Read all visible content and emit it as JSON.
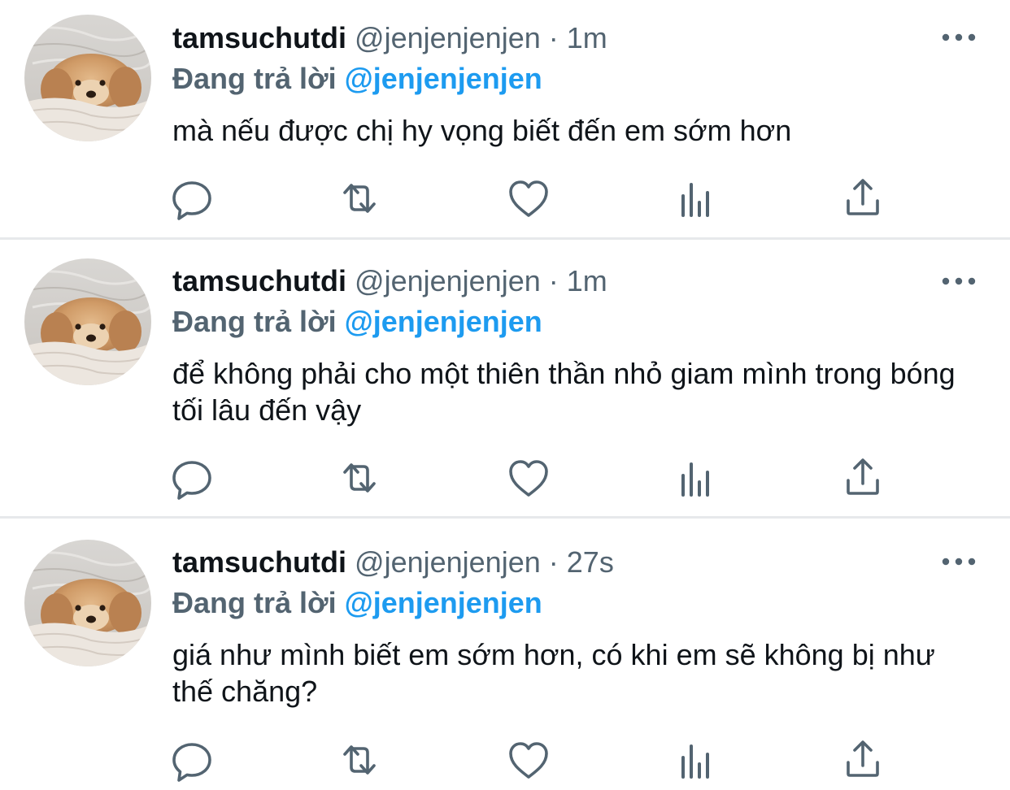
{
  "tweets": [
    {
      "display_name": "tamsuchutdi",
      "handle": "@jenjenjenjen",
      "separator": "·",
      "time": "1m",
      "reply_prefix": "Đang trả lời",
      "reply_to": "@jenjenjenjen",
      "text": "mà nếu được chị hy vọng biết đến em sớm hơn"
    },
    {
      "display_name": "tamsuchutdi",
      "handle": "@jenjenjenjen",
      "separator": "·",
      "time": "1m",
      "reply_prefix": "Đang trả lời",
      "reply_to": "@jenjenjenjen",
      "text": "để không phải cho một thiên thần nhỏ giam mình trong bóng tối lâu đến vậy"
    },
    {
      "display_name": "tamsuchutdi",
      "handle": "@jenjenjenjen",
      "separator": "·",
      "time": "27s",
      "reply_prefix": "Đang trả lời",
      "reply_to": "@jenjenjenjen",
      "text": "giá như mình biết em sớm hơn, có khi em sẽ không bị như thế chăng?"
    }
  ],
  "icons": {
    "avatar": "puppy-avatar",
    "more": "more-dots-icon",
    "reply": "reply-bubble-icon",
    "retweet": "retweet-icon",
    "like": "heart-icon",
    "stats": "analytics-bars-icon",
    "share": "share-upload-icon"
  },
  "colors": {
    "text": "#0f1419",
    "secondary": "#536471",
    "link": "#1d9bf0",
    "divider": "#e7e9eb"
  }
}
